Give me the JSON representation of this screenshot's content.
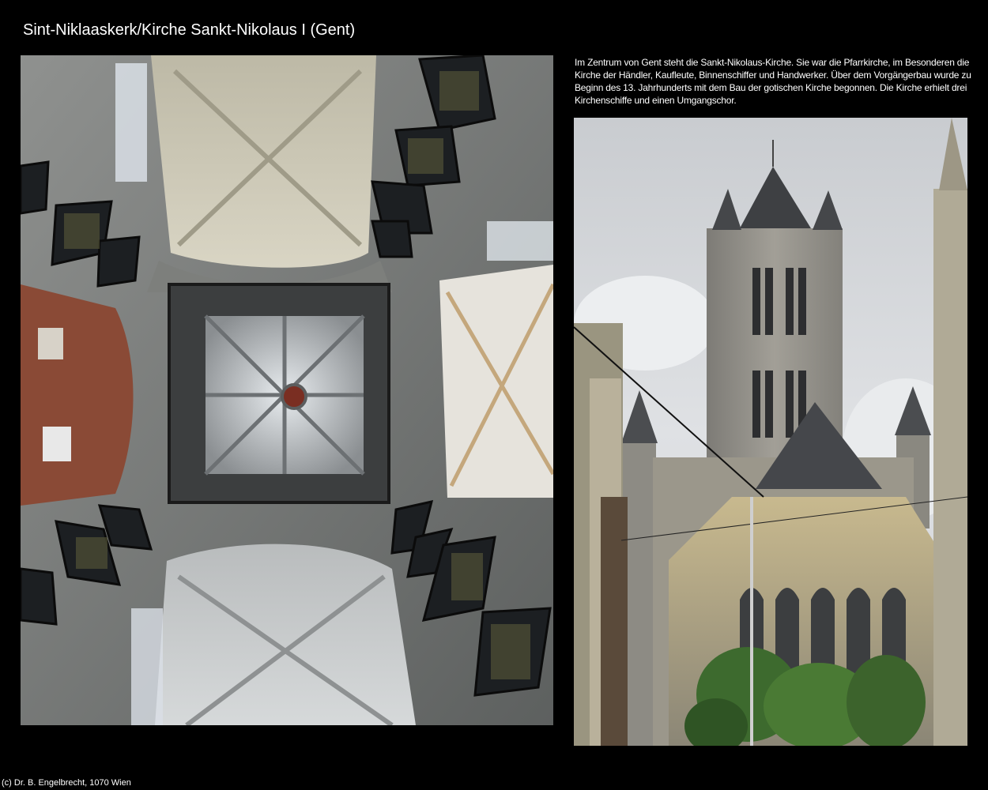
{
  "header": {
    "title": "Sint-Niklaaskerk/Kirche Sankt-Nikolaus I (Gent)"
  },
  "description": {
    "text": "Im Zentrum von Gent steht die Sankt-Nikolaus-Kirche. Sie war die Pfarrkirche, im Besonderen die Kirche der Händler, Kaufleute, Binnenschiffer und Handwerker. Über dem Vorgängerbau wurde zu Beginn des 13. Jahrhunderts mit dem Bau der gotischen Kirche begonnen. Die Kirche erhielt drei Kirchenschiffe und einen Umgangschor."
  },
  "footer": {
    "copyright": "(c) Dr. B. Engelbrecht, 1070 Wien"
  }
}
